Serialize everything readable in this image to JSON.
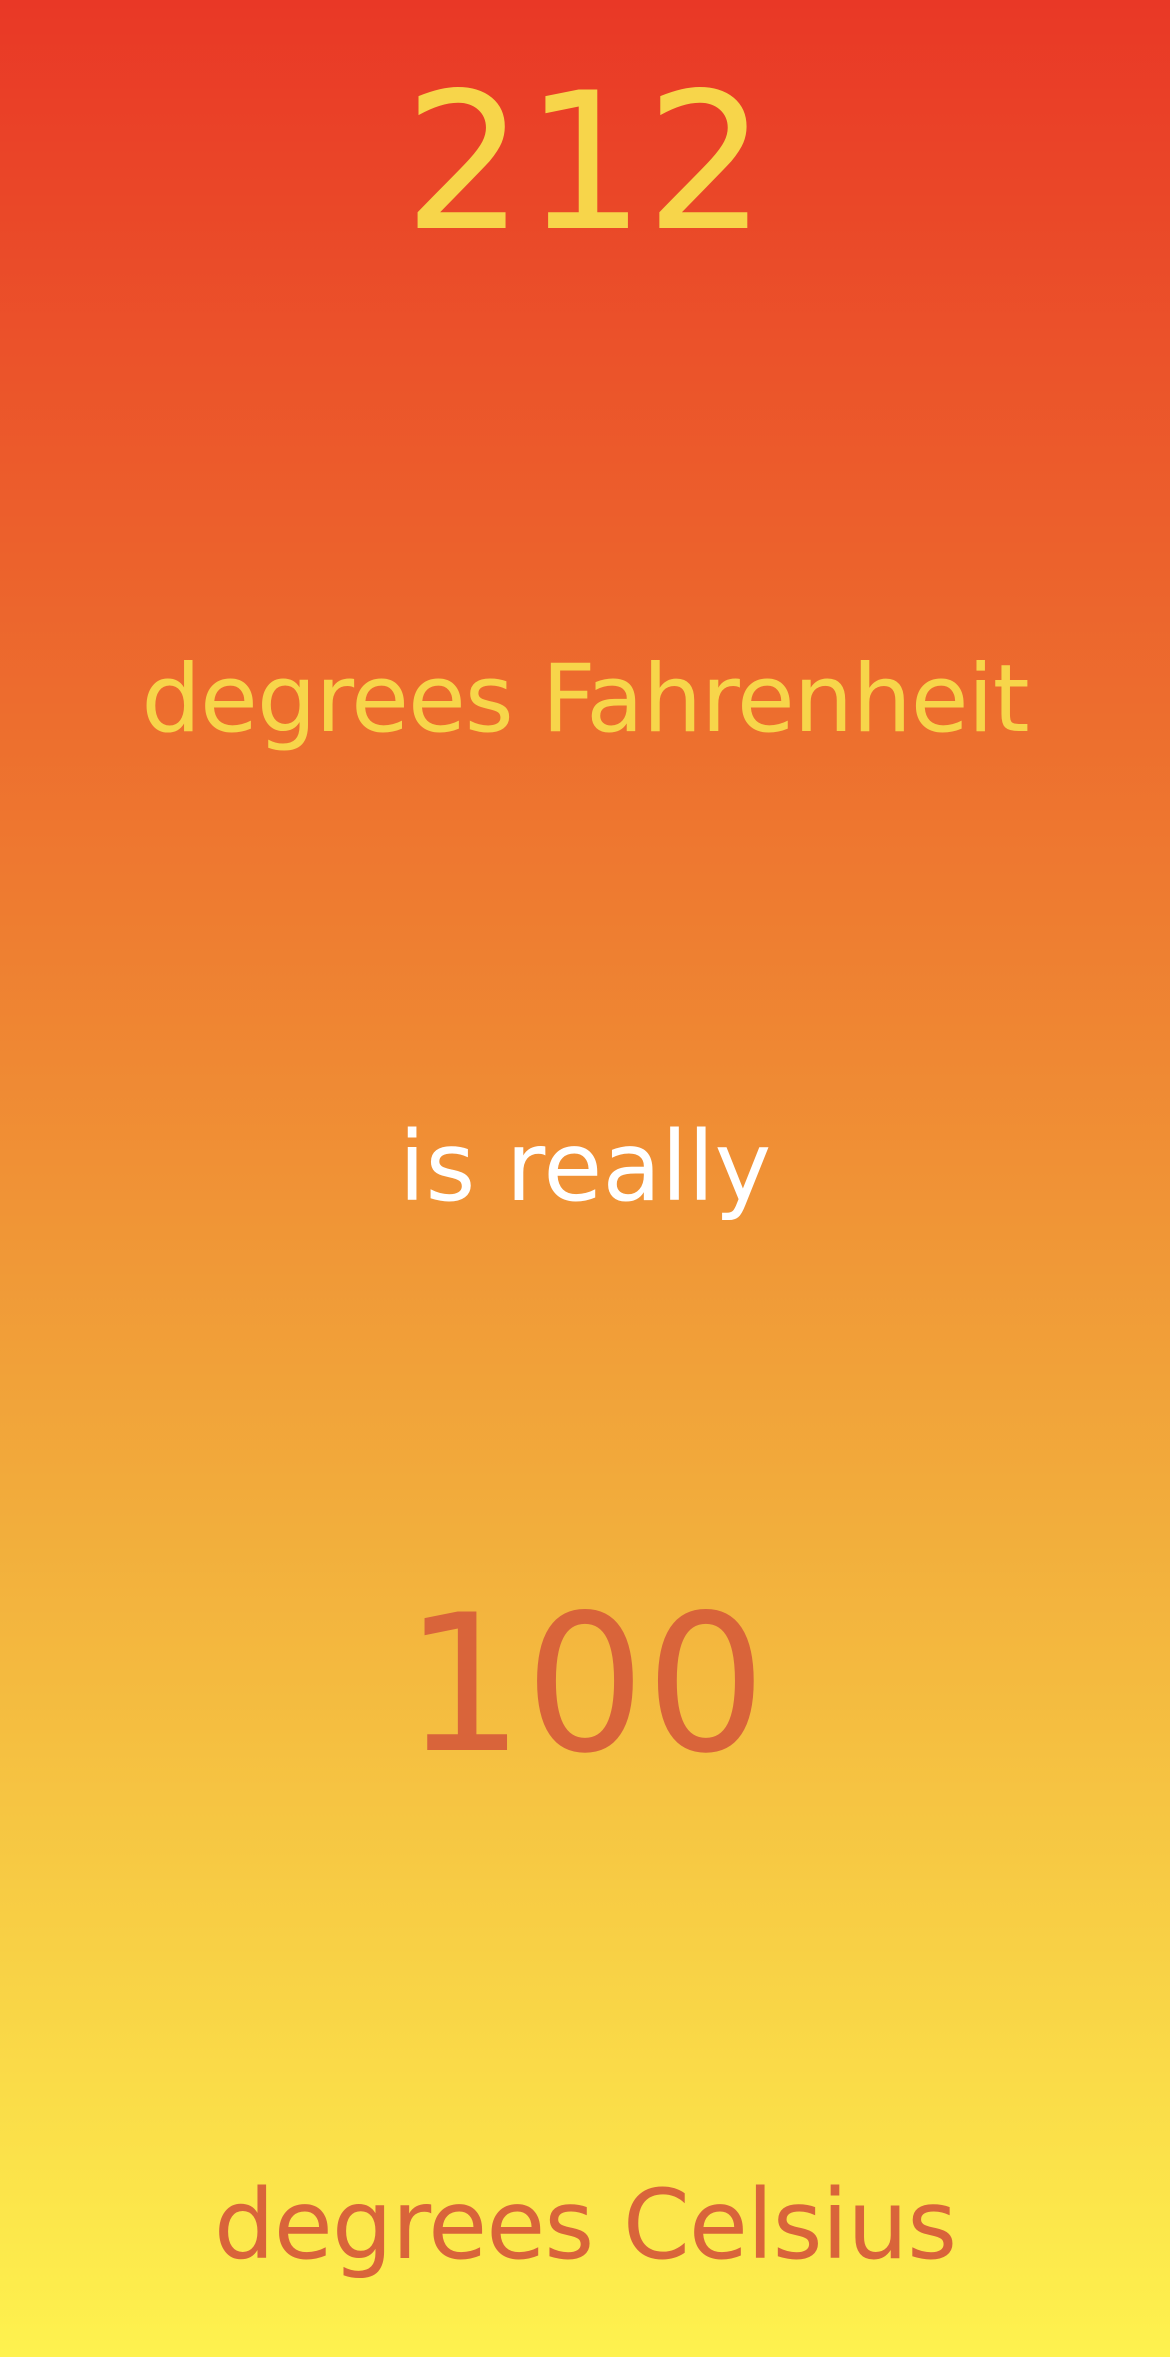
{
  "fahrenheit": {
    "value": "212",
    "unit_label": "degrees Fahrenheit"
  },
  "connector": "is really",
  "celsius": {
    "value": "100",
    "unit_label": "degrees Celsius"
  },
  "colors": {
    "gradient_top": "#E93826",
    "gradient_bottom": "#FEF24E",
    "fahrenheit_text": "#F7D54A",
    "connector_text": "#FFFFFF",
    "celsius_text": "#D9643A"
  }
}
